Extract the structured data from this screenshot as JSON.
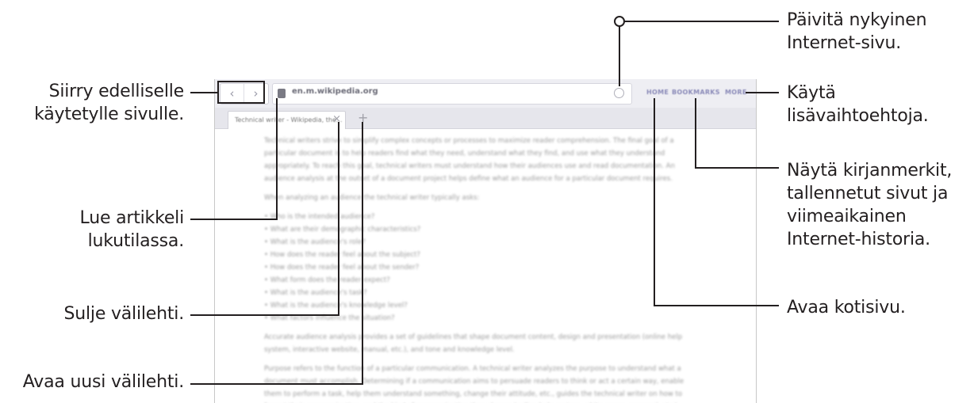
{
  "callouts": {
    "previous_page": "Siirry edelliselle käytetylle sivulle.",
    "reader_mode": "Lue artikkeli lukutilassa.",
    "close_tab": "Sulje välilehti.",
    "new_tab": "Avaa uusi välilehti.",
    "refresh": "Päivitä nykyinen Internet-sivu.",
    "more_options": "Käytä lisävaihtoehtoja.",
    "bookmarks": "Näytä kirjanmerkit, tallennetut sivut ja viimeaikainen Internet-historia.",
    "home": "Avaa kotisivu."
  },
  "browser": {
    "url": "en.m.wikipedia.org",
    "tab_title": "Technical writer - Wikipedia, the...",
    "menu": {
      "home": "HOME",
      "bookmarks": "BOOKMARKS",
      "more": "MORE"
    },
    "content": {
      "para1": "Technical writers strive to simplify complex concepts or processes to maximize reader comprehension. The final goal of a particular document is to help readers find what they need, understand what they find, and use what they understand appropriately. To reach this goal, technical writers must understand how their audiences use and read documentation. An audience analysis at the outset of a document project helps define what an audience for a particular document requires.",
      "para2": "When analyzing an audience the technical writer typically asks:",
      "bullets": [
        "Who is the intended audience?",
        "What are their demographic characteristics?",
        "What is the audience's role?",
        "How does the reader feel about the subject?",
        "How does the reader feel about the sender?",
        "What form does the reader expect?",
        "What is the audience's task?",
        "What is the audience's knowledge level?",
        "What factors influence the situation?"
      ],
      "para3": "Accurate audience analysis provides a set of guidelines that shape document content, design and presentation (online help system, interactive website, manual, etc.), and tone and knowledge level.",
      "para4": "Purpose refers to the function of a particular communication. A technical writer analyzes the purpose to understand what a document must accomplish. Determining if a communication aims to persuade readers to think or act a certain way, enable them to perform a task, help them understand something, change their attitude, etc., guides the technical writer on how to format their communication, and the kind of communication they choose (online help system, white paper, proposal, etc.)."
    }
  }
}
